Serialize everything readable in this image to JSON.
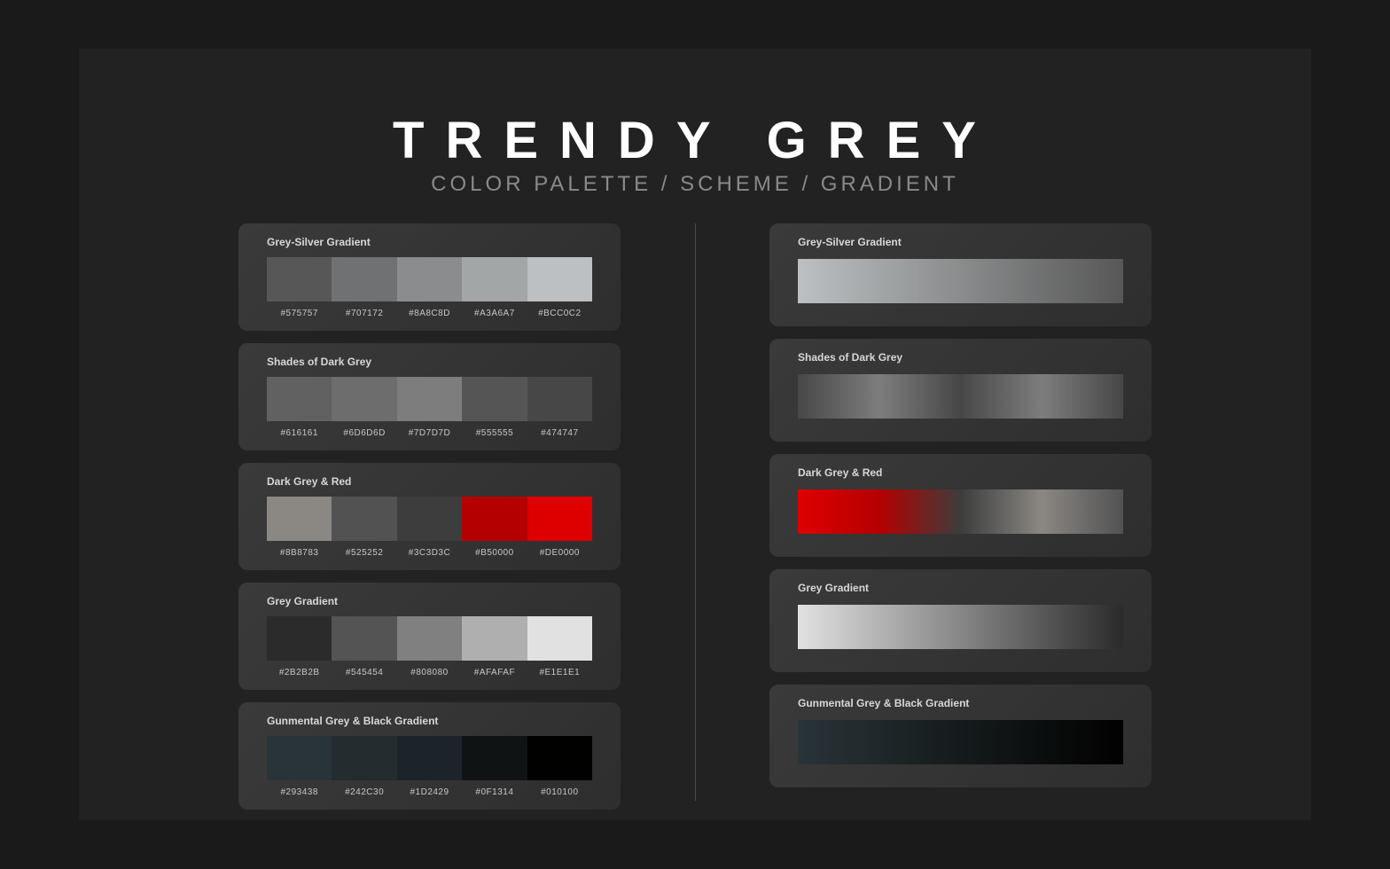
{
  "chart_data": {
    "type": "table",
    "title": "TRENDY GREY",
    "subtitle": "COLOR PALETTE / SCHEME / GRADIENT",
    "palettes": [
      {
        "name": "Grey-Silver Gradient",
        "colors": [
          "#575757",
          "#707172",
          "#8A8C8D",
          "#A3A6A7",
          "#BCC0C2"
        ]
      },
      {
        "name": "Shades of Dark Grey",
        "colors": [
          "#616161",
          "#6D6D6D",
          "#7D7D7D",
          "#555555",
          "#474747"
        ]
      },
      {
        "name": "Dark Grey & Red",
        "colors": [
          "#8B8783",
          "#525252",
          "#3C3D3C",
          "#B50000",
          "#DE0000"
        ]
      },
      {
        "name": "Grey Gradient",
        "colors": [
          "#2B2B2B",
          "#545454",
          "#808080",
          "#AFAFAF",
          "#E1E1E1"
        ]
      },
      {
        "name": "Gunmental Grey & Black Gradient",
        "colors": [
          "#293438",
          "#242C30",
          "#1D2429",
          "#0F1314",
          "#010100"
        ]
      }
    ]
  },
  "header": {
    "title": "TRENDY GREY",
    "subtitle": "COLOR PALETTE / SCHEME / GRADIENT"
  },
  "palettes": [
    {
      "name": "Grey-Silver Gradient",
      "colors": [
        "#575757",
        "#707172",
        "#8A8C8D",
        "#A3A6A7",
        "#BCC0C2"
      ]
    },
    {
      "name": "Shades of Dark Grey",
      "colors": [
        "#616161",
        "#6D6D6D",
        "#7D7D7D",
        "#555555",
        "#474747"
      ]
    },
    {
      "name": "Dark Grey & Red",
      "colors": [
        "#8B8783",
        "#525252",
        "#3C3D3C",
        "#B50000",
        "#DE0000"
      ]
    },
    {
      "name": "Grey Gradient",
      "colors": [
        "#2B2B2B",
        "#545454",
        "#808080",
        "#AFAFAF",
        "#E1E1E1"
      ]
    },
    {
      "name": "Gunmental Grey & Black Gradient",
      "colors": [
        "#293438",
        "#242C30",
        "#1D2429",
        "#0F1314",
        "#010100"
      ]
    }
  ],
  "gradients": [
    {
      "name": "Grey-Silver Gradient",
      "stops": [
        "#BCC0C2",
        "#575757"
      ]
    },
    {
      "name": "Shades of Dark Grey",
      "stops": [
        "#474747",
        "#7D7D7D",
        "#474747",
        "#7D7D7D",
        "#474747"
      ]
    },
    {
      "name": "Dark Grey & Red",
      "stops": [
        "#DE0000",
        "#B50000",
        "#3C3D3C",
        "#8B8783",
        "#525252"
      ]
    },
    {
      "name": "Grey Gradient",
      "stops": [
        "#E1E1E1",
        "#2B2B2B"
      ]
    },
    {
      "name": "Gunmental Grey & Black Gradient",
      "stops": [
        "#293438",
        "#010100"
      ]
    }
  ]
}
